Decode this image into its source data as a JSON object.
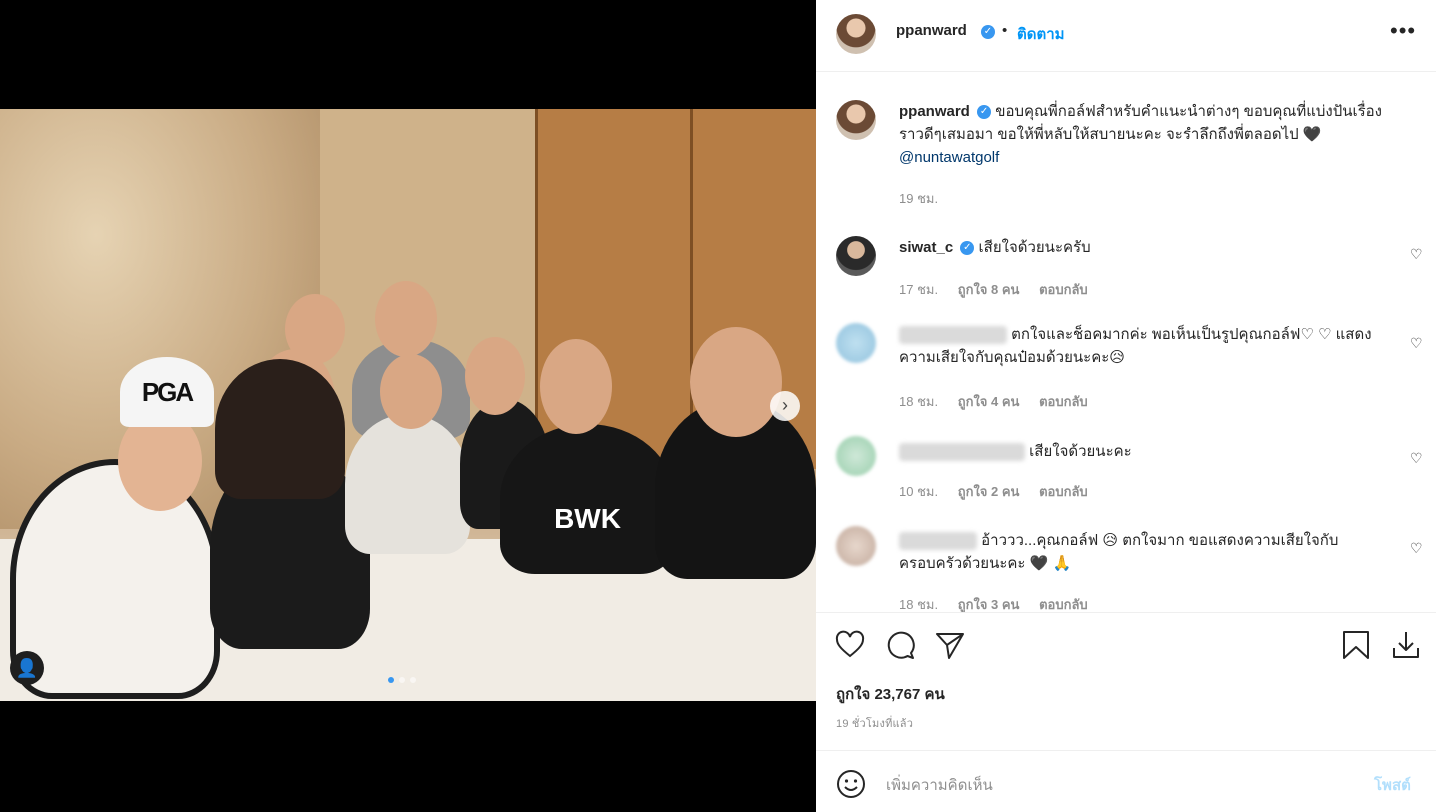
{
  "post": {
    "username": "ppanward",
    "follow_label": "ติดตาม",
    "bullet": "•",
    "more_icon": "more-options-icon",
    "caption": "ขอบคุณพี่กอล์ฟสำหรับคำแนะนำต่างๆ ขอบคุณที่แบ่งปันเรื่องราวดีๆเสมอมา ขอให้พี่หลับให้สบายนะคะ จะรำลึกถึงพี่ตลอดไป 🖤",
    "caption_mention": "@nuntawatgolf",
    "caption_time": "19 ชม.",
    "likes": "ถูกใจ 23,767 คน",
    "time_ago": "19 ชั่วโมงที่แล้ว",
    "add_comment_placeholder": "เพิ่มความคิดเห็น",
    "post_button": "โพสต์",
    "verified_mark": "✓"
  },
  "comments": [
    {
      "username": "siwat_c",
      "verified": true,
      "text": "เสียใจด้วยนะครับ",
      "time": "17 ชม.",
      "likes": "ถูกใจ 8 คน",
      "reply": "ตอบกลับ"
    },
    {
      "username": "",
      "verified": false,
      "text": "ตกใจและช็อคมากค่ะ พอเห็นเป็นรูปคุณกอล์ฟ♡ ♡ แสดงความเสียใจกับคุณป๋อมด้วยนะคะ😥",
      "time": "18 ชม.",
      "likes": "ถูกใจ 4 คน",
      "reply": "ตอบกลับ"
    },
    {
      "username": "",
      "verified": false,
      "text": "เสียใจด้วยนะคะ",
      "time": "10 ชม.",
      "likes": "ถูกใจ 2 คน",
      "reply": "ตอบกลับ"
    },
    {
      "username": "",
      "verified": false,
      "text": "อ้าววว...คุณกอล์ฟ 😥 ตกใจมาก ขอแสดงความเสียใจกับครอบครัวด้วยนะคะ 🖤 🙏",
      "time": "18 ชม.",
      "likes": "ถูกใจ 3 คน",
      "reply": "ตอบกลับ"
    }
  ],
  "media": {
    "photo_letters": "PGA",
    "shirt_letters": "BWK",
    "next_glyph": "›",
    "user_tag_glyph": "👤",
    "carousel_count": 3,
    "carousel_active": 0
  },
  "colors": {
    "link": "#0095f6",
    "mention": "#00376b",
    "muted": "#8e8e8e",
    "post_disabled": "#b2dffc",
    "verified": "#3897f0"
  }
}
